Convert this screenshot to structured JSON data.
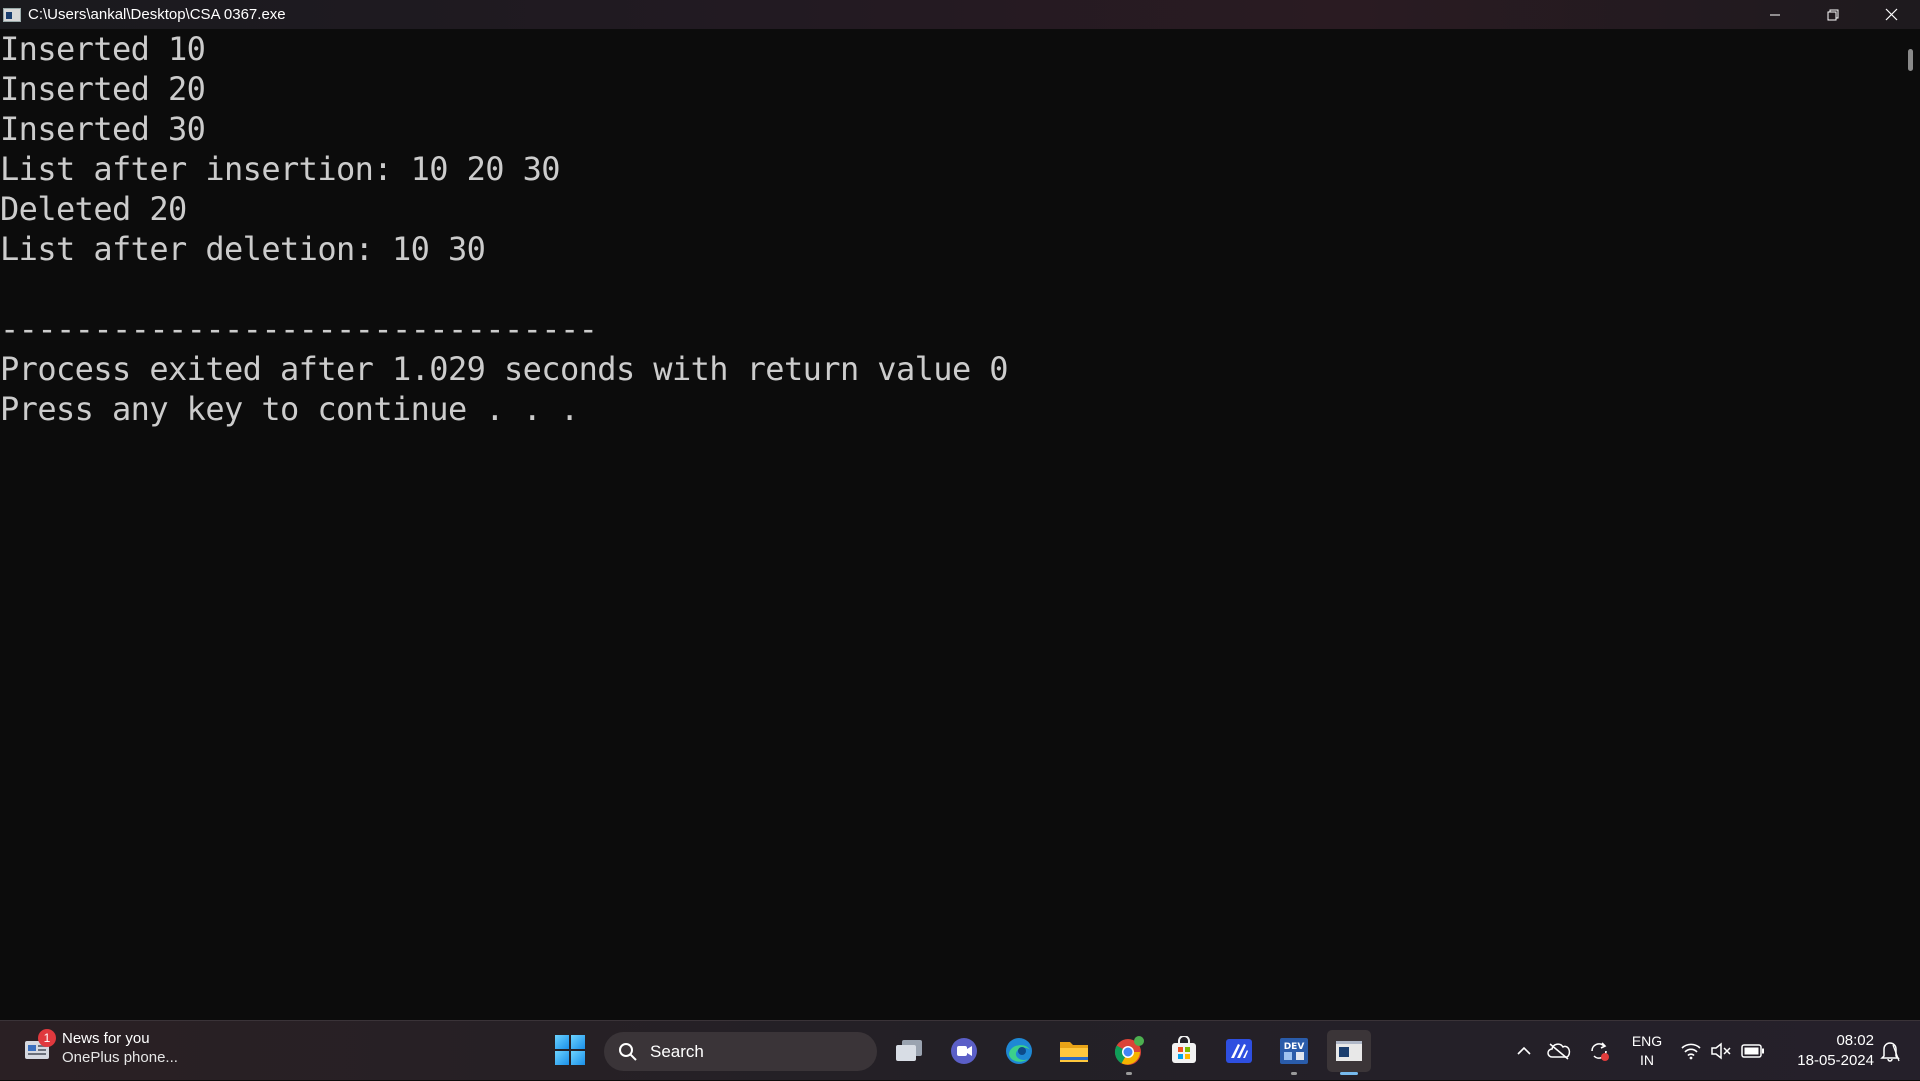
{
  "window": {
    "title": "C:\\Users\\ankal\\Desktop\\CSA 0367.exe",
    "controls": {
      "minimize": "minimize-icon",
      "restore": "restore-icon",
      "close": "close-icon"
    }
  },
  "console": {
    "lines": [
      "Inserted 10",
      "Inserted 20",
      "Inserted 30",
      "List after insertion: 10 20 30",
      "Deleted 20",
      "List after deletion: 10 30",
      "",
      "--------------------------------",
      "Process exited after 1.029 seconds with return value 0",
      "Press any key to continue . . ."
    ],
    "text_color": "#cccccc",
    "background": "#0c0c0c"
  },
  "taskbar": {
    "widget": {
      "badge": "1",
      "title": "News for you",
      "subtitle": "OnePlus phone..."
    },
    "search": {
      "label": "Search"
    },
    "apps": [
      {
        "name": "task-view",
        "active": false
      },
      {
        "name": "meet",
        "active": false
      },
      {
        "name": "edge",
        "active": false
      },
      {
        "name": "file-explorer",
        "active": false
      },
      {
        "name": "chrome",
        "active": false,
        "running": true
      },
      {
        "name": "microsoft-store",
        "active": false
      },
      {
        "name": "app-blue",
        "active": false
      },
      {
        "name": "dev-cpp",
        "active": false,
        "running": true
      },
      {
        "name": "console-window",
        "active": true
      }
    ],
    "tray": {
      "lang_top": "ENG",
      "lang_bottom": "IN",
      "time": "08:02",
      "date": "18-05-2024"
    },
    "accent": "#76b9ed"
  }
}
